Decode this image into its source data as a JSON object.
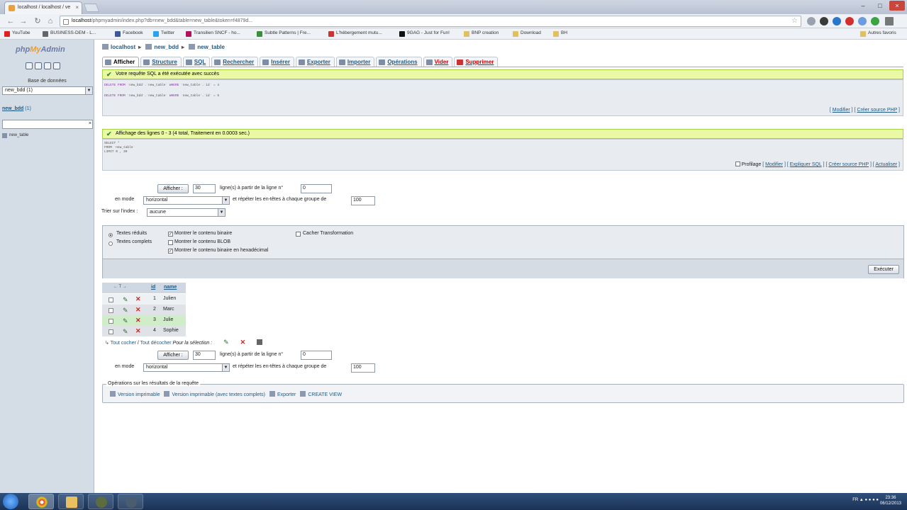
{
  "browser": {
    "tab_title": "localhost / localhost / ve",
    "url_host": "localhost",
    "url_path": "/phpmyadmin/index.php?db=new_bdd&table=new_table&token=f4879d...",
    "bookmarks": [
      "YouTube",
      "BUSINESS-DEM - L...",
      "Facebook",
      "Twitter",
      "Transilien SNCF - ho...",
      "Subtle Patterns | Fre...",
      "L'hébergement mutu...",
      "9GAG - Just for Fun!",
      "BNP creation",
      "Download",
      "BH",
      "Autres favoris"
    ]
  },
  "leftnav": {
    "logo_php": "php",
    "logo_my": "My",
    "logo_admin": "Admin",
    "db_label": "Base de données",
    "db_select": "new_bdd (1)",
    "db_link": "new_bdd",
    "db_count": "(1)",
    "table_item": "new_table"
  },
  "breadcrumb": {
    "server": "localhost",
    "db": "new_bdd",
    "table": "new_table"
  },
  "tabs": [
    "Afficher",
    "Structure",
    "SQL",
    "Rechercher",
    "Insérer",
    "Exporter",
    "Importer",
    "Opérations",
    "Vider",
    "Supprimer"
  ],
  "msg1": {
    "text": "Votre requête SQL a été exécutée avec succès",
    "sql1_kw1": "DELETE FROM",
    "sql1_rest": " `new_bdd`.`new_table` ",
    "sql1_kw2": "WHERE",
    "sql1_rest2": " `new_table`.`id` = 4",
    "sql2_kw1": "DELETE FROM",
    "sql2_rest": " `new_bdd`.`new_table` ",
    "sql2_kw2": "WHERE",
    "sql2_rest2": " `new_table`.`id` = 5",
    "link_modify": "Modifier",
    "link_php": "Créer source PHP"
  },
  "msg2": {
    "text": "Affichage des lignes 0 - 3 (4 total, Traitement en 0.0003 sec.)",
    "sql_l1": "SELECT *",
    "sql_l2": "FROM `new_table`",
    "sql_l3": "LIMIT 0 , 30",
    "profiling": "Profilage",
    "link_modify": "Modifier",
    "link_explain": "Expliquer SQL",
    "link_php": "Créer source PHP",
    "link_refresh": "Actualiser"
  },
  "nav": {
    "show_btn": "Afficher :",
    "rows_value": "30",
    "rows_label": "ligne(s) à partir de la ligne n°",
    "start_value": "0",
    "mode_label": "en mode",
    "mode_value": "horizontal",
    "repeat_label": "et répéter les en-têtes à chaque groupe de",
    "repeat_value": "100",
    "sort_label": "Trier sur l'index :",
    "sort_value": "aucune"
  },
  "options": {
    "partial": "Textes réduits",
    "full": "Textes complets",
    "binary": "Montrer le contenu binaire",
    "blob": "Montrer le contenu BLOB",
    "hex": "Montrer le contenu binaire en hexadécimal",
    "hide_transform": "Cacher Transformation",
    "exec_btn": "Exécuter"
  },
  "table": {
    "head_id": "id",
    "head_name": "name",
    "head_arrows": "← T →",
    "rows": [
      {
        "id": "1",
        "name": "Julien"
      },
      {
        "id": "2",
        "name": "Marc"
      },
      {
        "id": "3",
        "name": "Julie"
      },
      {
        "id": "4",
        "name": "Sophie"
      }
    ]
  },
  "withsel": {
    "check_all": "Tout cocher",
    "uncheck_all": "Tout décocher",
    "label": "Pour la sélection :"
  },
  "ops": {
    "legend": "Opérations sur les résultats de la requête",
    "print": "Version imprimable",
    "print_full": "Version imprimable (avec textes complets)",
    "export": "Exporter",
    "create_view": "CREATE VIEW"
  },
  "taskbar": {
    "lang": "FR",
    "time": "23:36",
    "date": "06/12/2013"
  }
}
